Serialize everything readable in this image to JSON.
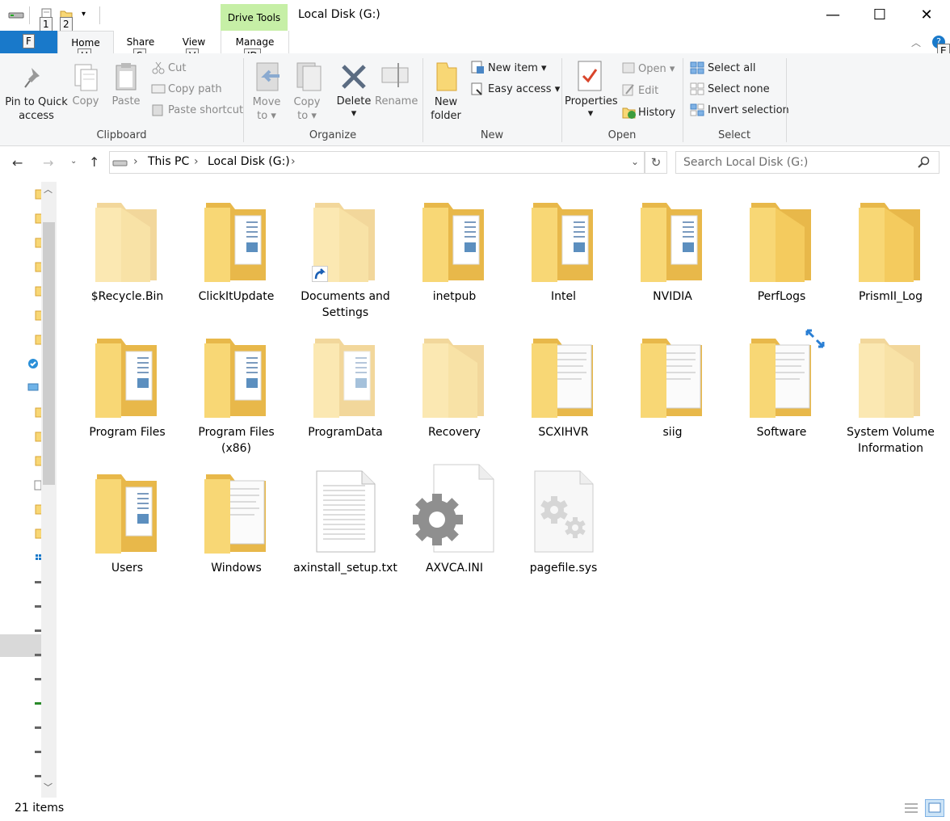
{
  "window": {
    "title": "Local Disk (G:)",
    "context_tab": "Drive Tools",
    "minimize": "—",
    "maximize": "☐",
    "close": "✕"
  },
  "quick_access": {
    "keytip1": "1",
    "keytip2": "2"
  },
  "tabs": {
    "file": "F",
    "home": "Home",
    "home_tip": "H",
    "share": "Share",
    "share_tip": "S",
    "view": "View",
    "view_tip": "V",
    "manage": "Manage",
    "manage_tip": "JD",
    "help_tip": "E"
  },
  "ribbon": {
    "clipboard": {
      "label": "Clipboard",
      "pin": "Pin to Quick access",
      "copy": "Copy",
      "paste": "Paste",
      "cut": "Cut",
      "copy_path": "Copy path",
      "paste_shortcut": "Paste shortcut"
    },
    "organize": {
      "label": "Organize",
      "move_to": "Move to",
      "copy_to": "Copy to",
      "delete": "Delete",
      "rename": "Rename"
    },
    "new": {
      "label": "New",
      "new_folder": "New folder",
      "new_item": "New item",
      "easy_access": "Easy access"
    },
    "open": {
      "label": "Open",
      "properties": "Properties",
      "open": "Open",
      "edit": "Edit",
      "history": "History"
    },
    "select": {
      "label": "Select",
      "select_all": "Select all",
      "select_none": "Select none",
      "invert": "Invert selection"
    }
  },
  "address": {
    "this_pc": "This PC",
    "drive": "Local Disk (G:)",
    "search_placeholder": "Search Local Disk (G:)"
  },
  "items": [
    {
      "name": "$Recycle.Bin",
      "type": "folder-empty",
      "faded": true
    },
    {
      "name": "ClickItUpdate",
      "type": "folder-docs"
    },
    {
      "name": "Documents and Settings",
      "type": "folder-empty",
      "faded": true,
      "shortcut": true
    },
    {
      "name": "inetpub",
      "type": "folder-docs"
    },
    {
      "name": "Intel",
      "type": "folder-docs"
    },
    {
      "name": "NVIDIA",
      "type": "folder-docs"
    },
    {
      "name": "PerfLogs",
      "type": "folder-empty"
    },
    {
      "name": "PrismII_Log",
      "type": "folder-empty"
    },
    {
      "name": "Program Files",
      "type": "folder-docs"
    },
    {
      "name": "Program Files (x86)",
      "type": "folder-docs"
    },
    {
      "name": "ProgramData",
      "type": "folder-docs",
      "faded": true
    },
    {
      "name": "Recovery",
      "type": "folder-empty",
      "faded": true
    },
    {
      "name": "SCXIHVR",
      "type": "folder-paper"
    },
    {
      "name": "siig",
      "type": "folder-paper"
    },
    {
      "name": "Software",
      "type": "folder-paper",
      "compressed": true
    },
    {
      "name": "System Volume Information",
      "type": "folder-empty",
      "faded": true
    },
    {
      "name": "Users",
      "type": "folder-docs"
    },
    {
      "name": "Windows",
      "type": "folder-paper"
    },
    {
      "name": "axinstall_setup.txt",
      "type": "text-file"
    },
    {
      "name": "AXVCA.INI",
      "type": "ini-file"
    },
    {
      "name": "pagefile.sys",
      "type": "sys-file",
      "faded": true
    }
  ],
  "status": {
    "count": "21 items"
  },
  "colors": {
    "file_tab": "#1979ca",
    "drive_tools": "#c6efa6",
    "folder": "#f8d775",
    "folder_back": "#e8b84a"
  }
}
